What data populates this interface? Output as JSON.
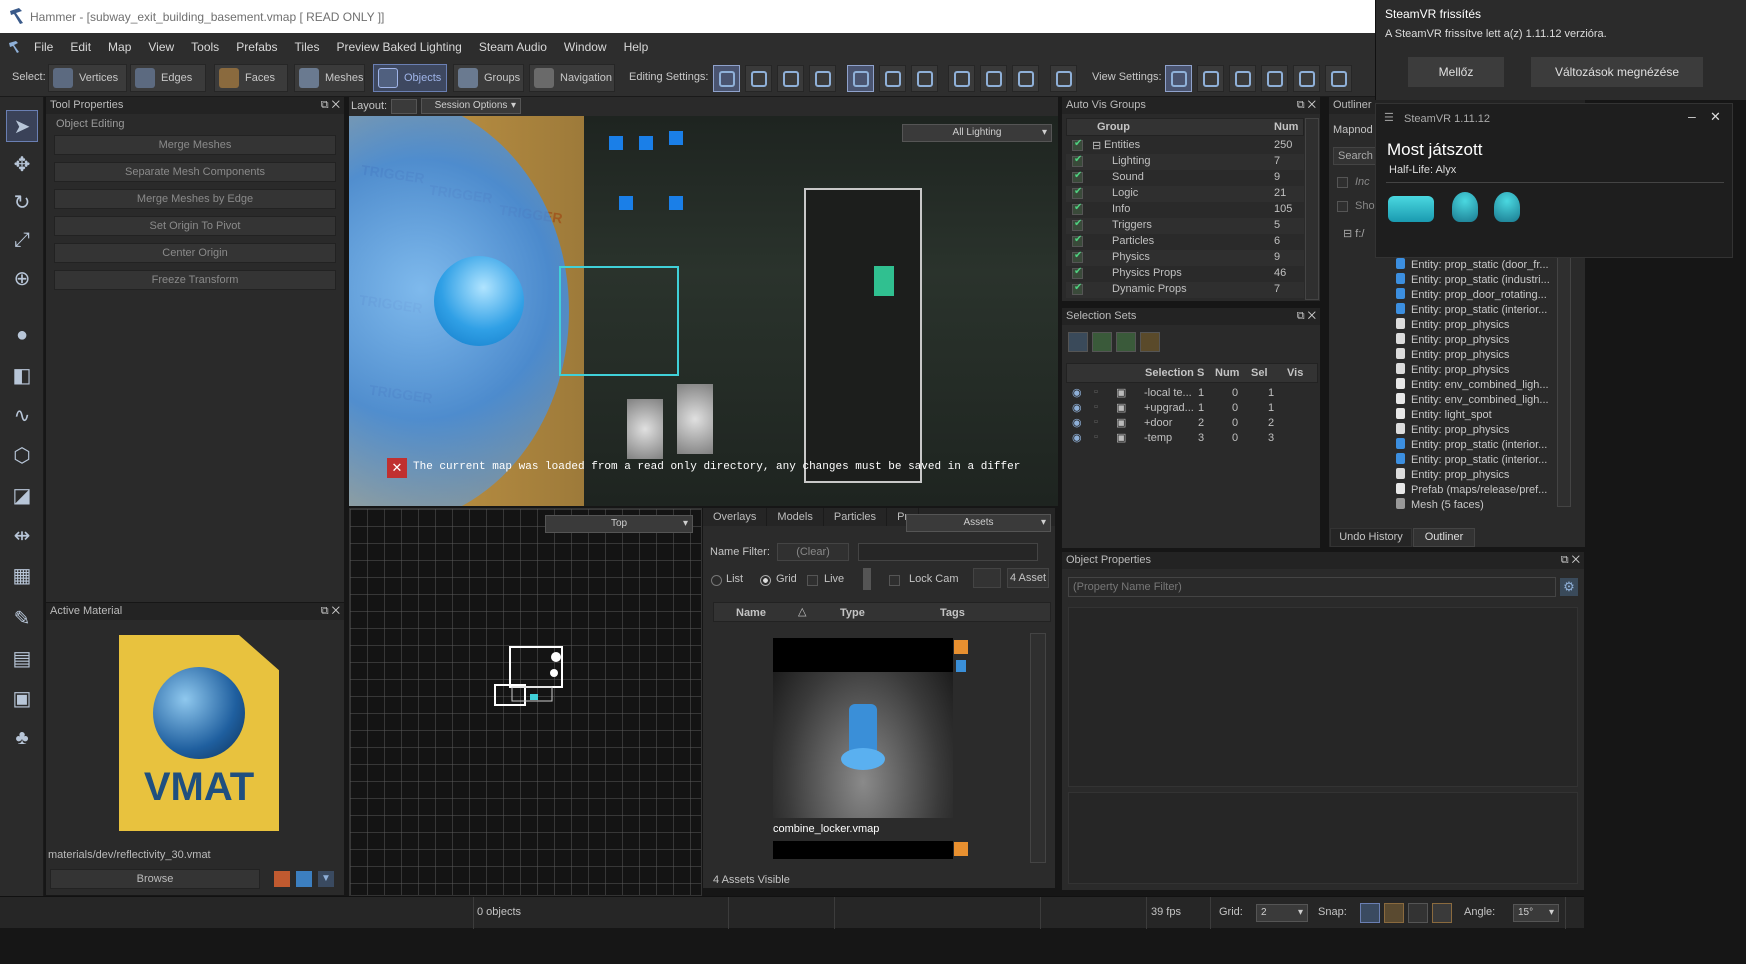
{
  "window": {
    "title": "Hammer - [subway_exit_building_basement.vmap [ READ ONLY ]]"
  },
  "menu": [
    "File",
    "Edit",
    "Map",
    "View",
    "Tools",
    "Prefabs",
    "Tiles",
    "Preview Baked Lighting",
    "Steam Audio",
    "Window",
    "Help"
  ],
  "toolbar": {
    "select_label": "Select:",
    "modes": [
      "Vertices",
      "Edges",
      "Faces",
      "Meshes",
      "Objects",
      "Groups",
      "Navigation"
    ],
    "active_mode": "Objects",
    "editing_settings_label": "Editing Settings:",
    "view_settings_label": "View Settings:"
  },
  "tool_properties": {
    "title": "Tool Properties",
    "section": "Object Editing",
    "buttons": [
      "Merge Meshes",
      "Separate Mesh Components",
      "Merge Meshes by Edge",
      "Set Origin To Pivot",
      "Center Origin",
      "Freeze Transform"
    ]
  },
  "layout_bar": {
    "label": "Layout:",
    "session_options": "Session Options"
  },
  "viewport3d": {
    "lighting_mode": "All Lighting",
    "readonly_message": "The current map was loaded from a read only directory, any changes must be saved in a differ",
    "trigger_text": "TRIGGER"
  },
  "view2d": {
    "mode": "Top"
  },
  "active_material": {
    "title": "Active Material",
    "thumbnail_text": "VMAT",
    "path": "materials/dev/reflectivity_30.vmat",
    "browse_label": "Browse"
  },
  "asset_browser": {
    "tabs": [
      "Overlays",
      "Models",
      "Particles",
      "Pr"
    ],
    "dropdown": "Assets",
    "name_filter_label": "Name Filter:",
    "clear_label": "(Clear)",
    "view_options": [
      "List",
      "Grid",
      "Live",
      "Lock Cam"
    ],
    "selected_view": "Grid",
    "asset_button": "4 Asset",
    "columns": [
      "Name",
      "Type",
      "Tags"
    ],
    "item_name": "combine_locker.vmap",
    "status": "4 Assets Visible"
  },
  "auto_vis_groups": {
    "title": "Auto Vis Groups",
    "columns": [
      "Group",
      "Num"
    ],
    "rows": [
      {
        "name": "Entities",
        "num": "250"
      },
      {
        "name": "Lighting",
        "num": "7"
      },
      {
        "name": "Sound",
        "num": "9"
      },
      {
        "name": "Logic",
        "num": "21"
      },
      {
        "name": "Info",
        "num": "105"
      },
      {
        "name": "Triggers",
        "num": "5"
      },
      {
        "name": "Particles",
        "num": "6"
      },
      {
        "name": "Physics",
        "num": "9"
      },
      {
        "name": "Physics Props",
        "num": "46"
      },
      {
        "name": "Dynamic Props",
        "num": "7"
      }
    ]
  },
  "selection_sets": {
    "title": "Selection Sets",
    "columns": [
      "Selection S",
      "Num",
      "Sel",
      "Vis"
    ],
    "rows": [
      {
        "name": "-local te...",
        "num": "1",
        "sel": "0",
        "vis": "1"
      },
      {
        "name": "+upgrad...",
        "num": "1",
        "sel": "0",
        "vis": "1"
      },
      {
        "name": "+door",
        "num": "2",
        "sel": "0",
        "vis": "2"
      },
      {
        "name": "-temp",
        "num": "3",
        "sel": "0",
        "vis": "3"
      }
    ]
  },
  "outliner": {
    "title": "Outliner",
    "mapnode_label": "Mapnod",
    "search_label": "Search",
    "opt1": "Inc",
    "opt2": "Sho",
    "root": "f:/",
    "items": [
      "Entity: prop_static (door_fr...",
      "Entity: prop_static (industri...",
      "Entity: prop_door_rotating...",
      "Entity: prop_static (interior...",
      "Entity: prop_physics",
      "Entity: prop_physics",
      "Entity: prop_physics",
      "Entity: prop_physics",
      "Entity: env_combined_ligh...",
      "Entity: env_combined_ligh...",
      "Entity: light_spot",
      "Entity: prop_physics",
      "Entity: prop_static (interior...",
      "Entity: prop_static (interior...",
      "Entity: prop_physics",
      "Prefab (maps/release/pref...",
      "Mesh (5 faces)"
    ],
    "tabs": [
      "Undo History",
      "Outliner"
    ]
  },
  "object_properties": {
    "title": "Object Properties",
    "filter_placeholder": "(Property Name Filter)"
  },
  "status_bar": {
    "objects": "0 objects",
    "fps": "39 fps",
    "grid_label": "Grid:",
    "grid_value": "2",
    "snap_label": "Snap:",
    "angle_label": "Angle:",
    "angle_value": "15°"
  },
  "notification": {
    "title": "SteamVR frissítés",
    "message": "A SteamVR frissítve lett a(z) 1.11.12 verzióra.",
    "dismiss": "Mellőz",
    "view_changes": "Változások megnézése"
  },
  "steamvr_overlay": {
    "title": "SteamVR 1.11.12",
    "heading": "Most játszott",
    "game": "Half-Life: Alyx"
  },
  "colors": {
    "accent": "#6a7fb3",
    "check": "#4fd080",
    "vmat": "#e8c23e"
  }
}
